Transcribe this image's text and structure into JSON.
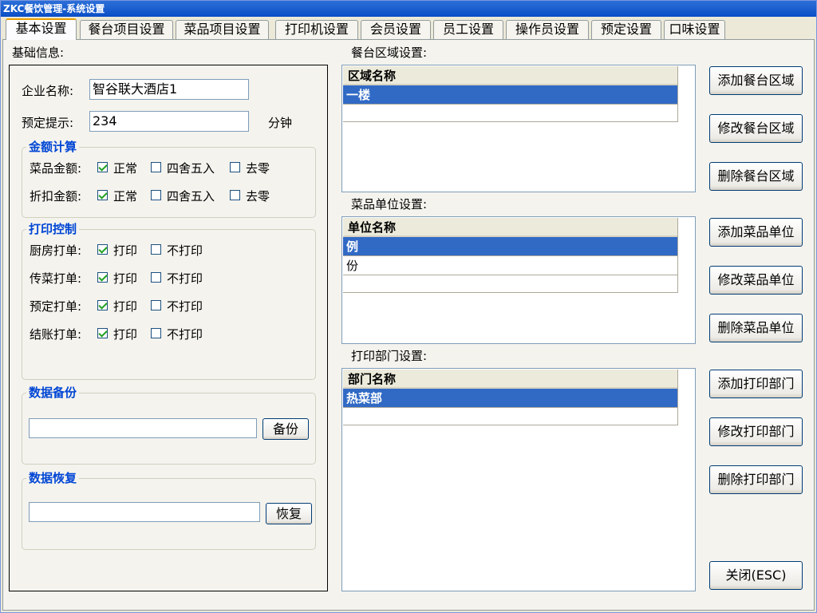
{
  "window": {
    "title": "ZKC餐饮管理-系统设置"
  },
  "tabs": [
    {
      "label": "基本设置"
    },
    {
      "label": "餐台项目设置"
    },
    {
      "label": "菜品项目设置"
    },
    {
      "label": "打印机设置"
    },
    {
      "label": "会员设置"
    },
    {
      "label": "员工设置"
    },
    {
      "label": "操作员设置"
    },
    {
      "label": "预定设置"
    },
    {
      "label": "口味设置"
    }
  ],
  "basic": {
    "section_label": "基础信息:",
    "company_label": "企业名称:",
    "company_value": "智谷联大酒店1",
    "reserve_label": "预定提示:",
    "reserve_value": "234",
    "reserve_unit": "分钟"
  },
  "amount_calc": {
    "title": "金额计算",
    "rows": [
      {
        "label": "菜品金额:",
        "options": [
          "正常",
          "四舍五入",
          "去零"
        ],
        "checked": [
          true,
          false,
          false
        ]
      },
      {
        "label": "折扣金额:",
        "options": [
          "正常",
          "四舍五入",
          "去零"
        ],
        "checked": [
          true,
          false,
          false
        ]
      }
    ]
  },
  "print_control": {
    "title": "打印控制",
    "rows": [
      {
        "label": "厨房打单:",
        "options": [
          "打印",
          "不打印"
        ],
        "checked": [
          true,
          false
        ]
      },
      {
        "label": "传菜打单:",
        "options": [
          "打印",
          "不打印"
        ],
        "checked": [
          true,
          false
        ]
      },
      {
        "label": "预定打单:",
        "options": [
          "打印",
          "不打印"
        ],
        "checked": [
          true,
          false
        ]
      },
      {
        "label": "结账打单:",
        "options": [
          "打印",
          "不打印"
        ],
        "checked": [
          true,
          false
        ]
      }
    ]
  },
  "backup": {
    "title": "数据备份",
    "value": "",
    "button": "备份"
  },
  "restore": {
    "title": "数据恢复",
    "value": "",
    "button": "恢复"
  },
  "area": {
    "section_label": "餐台区域设置:",
    "column": "区域名称",
    "rows": [
      "一楼"
    ],
    "buttons": [
      "添加餐台区域",
      "修改餐台区域",
      "删除餐台区域"
    ]
  },
  "unit": {
    "section_label": "菜品单位设置:",
    "column": "单位名称",
    "rows": [
      "例",
      "份"
    ],
    "buttons": [
      "添加菜品单位",
      "修改菜品单位",
      "删除菜品单位"
    ]
  },
  "dept": {
    "section_label": "打印部门设置:",
    "column": "部门名称",
    "rows": [
      "热菜部"
    ],
    "buttons": [
      "添加打印部门",
      "修改打印部门",
      "删除打印部门"
    ]
  },
  "close_button": "关闭(ESC)"
}
